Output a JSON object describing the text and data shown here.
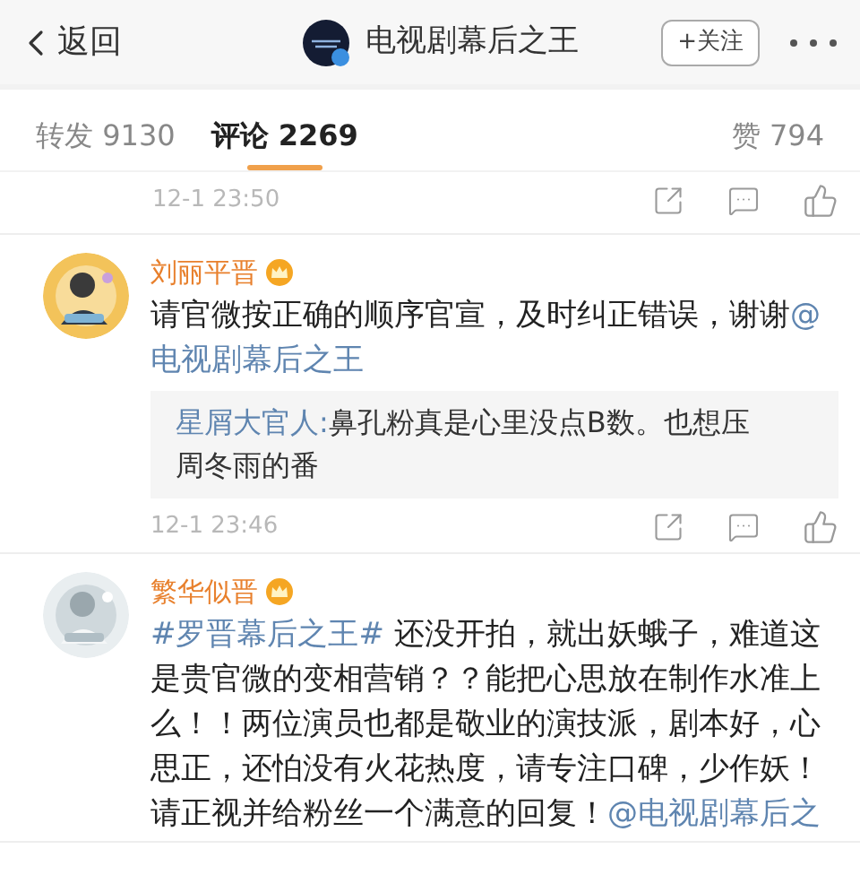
{
  "header": {
    "back_label": "返回",
    "account_name": "电视剧幕后之王",
    "follow_button": "+关注"
  },
  "tabs": [
    {
      "label": "转发 9130",
      "selected": false
    },
    {
      "label": "评论 2269",
      "selected": true
    }
  ],
  "likes_tab": {
    "label": "赞 794",
    "selected": false
  },
  "comments": [
    {
      "kind": "stub",
      "time": "12-1 23:50"
    },
    {
      "kind": "full",
      "name": "刘丽平晋",
      "lines": [
        [
          {
            "kind": "plain",
            "text": "请官微按正确的顺序官宣，及时纠正错误，谢谢"
          },
          {
            "kind": "link",
            "text": "@"
          }
        ],
        [
          {
            "kind": "link",
            "text": "电视剧幕后之王"
          }
        ]
      ],
      "reply": {
        "author": "星屑大官人:",
        "lines": [
          "鼻孔粉真是心里没点B数。也想压",
          "周冬雨的番"
        ]
      },
      "time": "12-1 23:46"
    },
    {
      "kind": "full",
      "name": "繁华似晋",
      "lines": [
        [
          {
            "kind": "link",
            "text": "#罗晋幕后之王#"
          },
          {
            "kind": "plain",
            "text": " 还没开拍，就出妖蛾子，难道这"
          }
        ],
        [
          {
            "kind": "plain",
            "text": "是贵官微的变相营销？？能把心思放在制作水准上"
          }
        ],
        [
          {
            "kind": "plain",
            "text": "么！！两位演员也都是敬业的演技派，剧本好，心"
          }
        ],
        [
          {
            "kind": "plain",
            "text": "思正，还怕没有火花热度，请专注口碑，少作妖！"
          }
        ],
        [
          {
            "kind": "plain",
            "text": "请正视并给粉丝一个满意的回复！"
          },
          {
            "kind": "link",
            "text": "@电视剧幕后之"
          }
        ]
      ]
    }
  ]
}
